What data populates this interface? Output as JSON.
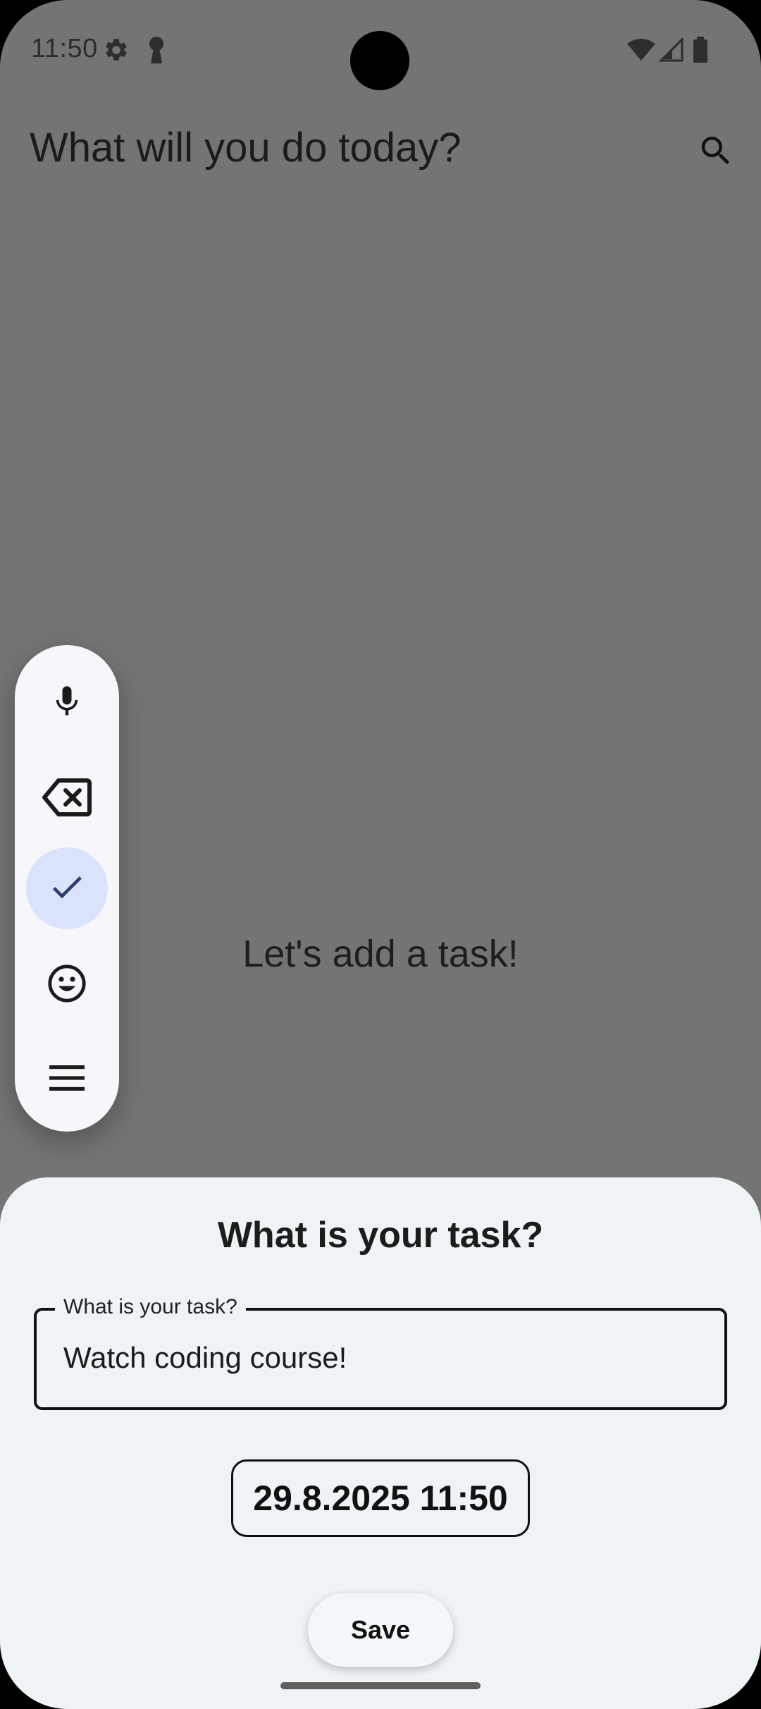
{
  "status_bar": {
    "time": "11:50",
    "icons": [
      "settings-gear-icon",
      "keyhole-icon",
      "wifi-icon",
      "signal-icon",
      "battery-icon"
    ]
  },
  "app_bar": {
    "title": "What will you do today?",
    "search_icon": "search-icon"
  },
  "main": {
    "empty_message": "Let's add a task!"
  },
  "toolbar": {
    "items": [
      {
        "name": "mic",
        "icon": "mic-icon",
        "selected": false
      },
      {
        "name": "backspace",
        "icon": "backspace-icon",
        "selected": false
      },
      {
        "name": "check",
        "icon": "check-icon",
        "selected": true
      },
      {
        "name": "emoji",
        "icon": "emoji-icon",
        "selected": false
      },
      {
        "name": "menu",
        "icon": "menu-icon",
        "selected": false
      }
    ]
  },
  "sheet": {
    "title": "What is your task?",
    "task_field": {
      "label": "What is your task?",
      "value": "Watch coding course!"
    },
    "date_button": "29.8.2025 11:50",
    "save_button": "Save"
  },
  "colors": {
    "scrim": "#747474",
    "sheet_bg": "#eef3f6",
    "toolbar_bg": "#f7f7fb",
    "selected_tool_bg": "#dbe2fb",
    "accent": "#2f3f6b"
  }
}
